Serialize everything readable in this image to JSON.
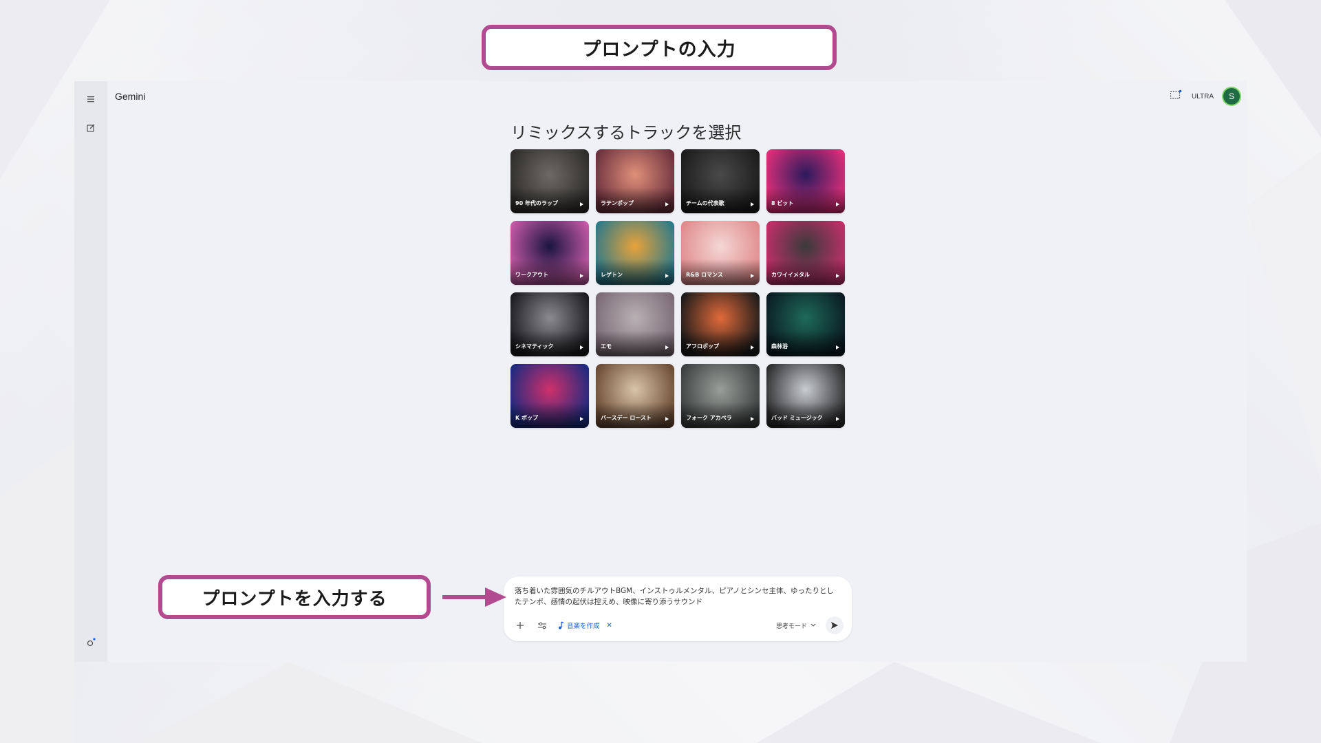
{
  "callouts": {
    "top": "プロンプトの入力",
    "bottom": "プロンプトを入力する"
  },
  "app": {
    "title": "Gemini",
    "plan_badge": "ULTRA",
    "avatar_initial": "S"
  },
  "main": {
    "heading": "リミックスするトラックを選択",
    "tracks": [
      {
        "label": "90 年代のラップ",
        "icon": "track-art-90s-rap",
        "colors": [
          "#6d6a66",
          "#2e2c2a"
        ]
      },
      {
        "label": "ラテンポップ",
        "icon": "track-art-latin-pop",
        "colors": [
          "#e0907a",
          "#6a2f3d"
        ]
      },
      {
        "label": "チームの代表歌",
        "icon": "track-art-team-anthem",
        "colors": [
          "#4a4a4a",
          "#1b1b1b"
        ]
      },
      {
        "label": "8 ビット",
        "icon": "track-art-8bit",
        "colors": [
          "#2b1a5c",
          "#e0307a"
        ]
      },
      {
        "label": "ワークアウト",
        "icon": "track-art-workout",
        "colors": [
          "#1a1540",
          "#c75aa8"
        ]
      },
      {
        "label": "レゲトン",
        "icon": "track-art-reggaeton",
        "colors": [
          "#e8a23a",
          "#2a7a8a"
        ]
      },
      {
        "label": "R&B ロマンス",
        "icon": "track-art-rnb-romance",
        "colors": [
          "#f4d7d5",
          "#e08a8a"
        ]
      },
      {
        "label": "カワイイメタル",
        "icon": "track-art-kawaii-metal",
        "colors": [
          "#3a3a3a",
          "#c2306a"
        ]
      },
      {
        "label": "シネマティック",
        "icon": "track-art-cinematic",
        "colors": [
          "#8a8a90",
          "#1a1a1e"
        ]
      },
      {
        "label": "エモ",
        "icon": "track-art-emo",
        "colors": [
          "#b9b0b4",
          "#7a6a74"
        ]
      },
      {
        "label": "アフロポップ",
        "icon": "track-art-afropop",
        "colors": [
          "#e06a3a",
          "#1a1a1a"
        ]
      },
      {
        "label": "森林浴",
        "icon": "track-art-forest-bath",
        "colors": [
          "#1e6a5a",
          "#0a1a22"
        ]
      },
      {
        "label": "K ポップ",
        "icon": "track-art-kpop",
        "colors": [
          "#d0306a",
          "#1a2a80"
        ]
      },
      {
        "label": "バースデー ロースト",
        "icon": "track-art-birthday-roast",
        "colors": [
          "#d9c4a6",
          "#6a4a34"
        ]
      },
      {
        "label": "フォーク アカペラ",
        "icon": "track-art-folk-acapella",
        "colors": [
          "#9a9e9a",
          "#3a3e3e"
        ]
      },
      {
        "label": "バッド ミュージック",
        "icon": "track-art-bad-music",
        "colors": [
          "#c9ccd0",
          "#2a2a2c"
        ]
      }
    ]
  },
  "prompt": {
    "text": "落ち着いた雰囲気のチルアウトBGM、インストゥルメンタル、ピアノとシンセ主体、ゆったりとしたテンポ、感情の起伏は控えめ、映像に寄り添うサウンド",
    "tool_chip": "音楽を作成",
    "mode": "思考モード"
  },
  "colors": {
    "callout_border": "#b14a8f",
    "accent": "#1a5fd6"
  }
}
